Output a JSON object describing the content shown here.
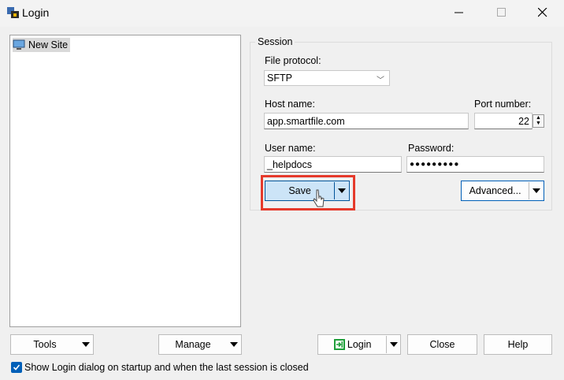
{
  "window": {
    "title": "Login",
    "minimize_glyph": "—",
    "maximize_glyph": "☐",
    "close_glyph": "✕"
  },
  "sites": {
    "items": [
      {
        "label": "New Site",
        "icon": "monitor-icon"
      }
    ]
  },
  "session": {
    "group_label": "Session",
    "file_protocol_label": "File protocol:",
    "file_protocol_value": "SFTP",
    "host_name_label": "Host name:",
    "host_name_value": "app.smartfile.com",
    "port_label": "Port number:",
    "port_value": "22",
    "user_name_label": "User name:",
    "user_name_value": "_helpdocs",
    "password_label": "Password:",
    "password_value": "●●●●●●●●●",
    "save_label": "Save",
    "advanced_label": "Advanced..."
  },
  "bottom": {
    "tools_label": "Tools",
    "manage_label": "Manage",
    "login_label": "Login",
    "close_label": "Close",
    "help_label": "Help",
    "startup_checkbox_label": "Show Login dialog on startup and when the last session is closed",
    "startup_checked": true
  },
  "colors": {
    "accent": "#005fb8",
    "highlight": "#e53a2b",
    "save_bg": "#cce4f7",
    "login_icon": "#1f9e3a"
  }
}
